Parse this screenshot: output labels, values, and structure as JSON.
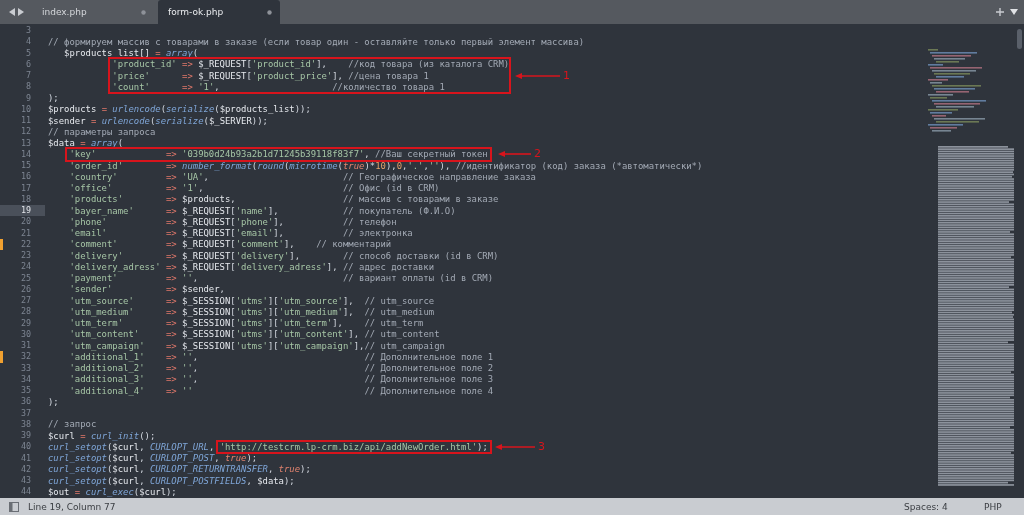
{
  "tabs": [
    {
      "label": "index.php",
      "selected": false
    },
    {
      "label": "form-ok.php",
      "selected": true
    }
  ],
  "lines": [
    {
      "number": "3",
      "current": false,
      "modified": false
    },
    {
      "number": "4",
      "current": false,
      "modified": false,
      "tokens": [
        {
          "kind": "comment",
          "text": "// формируем массив с товарами в заказе (если товар один - оставляйте только первый элемент массива)"
        }
      ]
    },
    {
      "number": "5",
      "current": false,
      "modified": false,
      "tokens": [
        {
          "kind": "var",
          "text": "   $products_list[]"
        },
        {
          "kind": "operator",
          "text": " = "
        },
        {
          "kind": "func",
          "text": "array"
        },
        {
          "kind": "text",
          "text": "("
        }
      ]
    },
    {
      "number": "6",
      "current": false,
      "modified": false,
      "tokens": [
        {
          "kind": "string",
          "text": "            'product_id'"
        },
        {
          "kind": "operator",
          "text": " => "
        },
        {
          "kind": "var",
          "text": "$_REQUEST"
        },
        {
          "kind": "text",
          "text": "["
        },
        {
          "kind": "string",
          "text": "'product_id'"
        },
        {
          "kind": "text",
          "text": "],    "
        },
        {
          "kind": "comment",
          "text": "//код товара (из каталога CRM)"
        }
      ]
    },
    {
      "number": "7",
      "current": false,
      "modified": false,
      "tokens": [
        {
          "kind": "string",
          "text": "            'price'"
        },
        {
          "kind": "operator",
          "text": "      => "
        },
        {
          "kind": "var",
          "text": "$_REQUEST"
        },
        {
          "kind": "text",
          "text": "["
        },
        {
          "kind": "string",
          "text": "'product_price'"
        },
        {
          "kind": "text",
          "text": "], "
        },
        {
          "kind": "comment",
          "text": "//цена товара 1"
        }
      ]
    },
    {
      "number": "8",
      "current": false,
      "modified": false,
      "tokens": [
        {
          "kind": "string",
          "text": "            'count'"
        },
        {
          "kind": "operator",
          "text": "      => "
        },
        {
          "kind": "string",
          "text": "'1'"
        },
        {
          "kind": "text",
          "text": ",                     "
        },
        {
          "kind": "comment",
          "text": "//количество товара 1"
        }
      ]
    },
    {
      "number": "9",
      "current": false,
      "modified": false,
      "tokens": [
        {
          "kind": "text",
          "text": ");"
        }
      ]
    },
    {
      "number": "10",
      "current": false,
      "modified": false,
      "tokens": [
        {
          "kind": "var",
          "text": "$products"
        },
        {
          "kind": "operator",
          "text": " = "
        },
        {
          "kind": "func",
          "text": "urlencode"
        },
        {
          "kind": "text",
          "text": "("
        },
        {
          "kind": "func",
          "text": "serialize"
        },
        {
          "kind": "text",
          "text": "("
        },
        {
          "kind": "var",
          "text": "$products_list"
        },
        {
          "kind": "text",
          "text": "));"
        }
      ]
    },
    {
      "number": "11",
      "current": false,
      "modified": false,
      "tokens": [
        {
          "kind": "var",
          "text": "$sender"
        },
        {
          "kind": "operator",
          "text": " = "
        },
        {
          "kind": "func",
          "text": "urlencode"
        },
        {
          "kind": "text",
          "text": "("
        },
        {
          "kind": "func",
          "text": "serialize"
        },
        {
          "kind": "text",
          "text": "("
        },
        {
          "kind": "var",
          "text": "$_SERVER"
        },
        {
          "kind": "text",
          "text": "));"
        }
      ]
    },
    {
      "number": "12",
      "current": false,
      "modified": false,
      "tokens": [
        {
          "kind": "comment",
          "text": "// параметры запроса"
        }
      ]
    },
    {
      "number": "13",
      "current": false,
      "modified": false,
      "tokens": [
        {
          "kind": "var",
          "text": "$data"
        },
        {
          "kind": "operator",
          "text": " = "
        },
        {
          "kind": "func",
          "text": "array"
        },
        {
          "kind": "text",
          "text": "("
        }
      ]
    },
    {
      "number": "14",
      "current": false,
      "modified": false,
      "tokens": [
        {
          "kind": "string",
          "text": "    'key'",
          "boxed": true
        },
        {
          "kind": "operator",
          "text": "             => ",
          "boxed": true
        },
        {
          "kind": "string",
          "text": "'039b0d24b93a2b1d71245b39118f83f7'",
          "boxed": true
        },
        {
          "kind": "text",
          "text": ", ",
          "boxed": true
        },
        {
          "kind": "comment",
          "text": "//Ваш секретный токен",
          "boxed": true
        }
      ]
    },
    {
      "number": "15",
      "current": false,
      "modified": false,
      "tokens": [
        {
          "kind": "string",
          "text": "    'order_id'"
        },
        {
          "kind": "operator",
          "text": "        => "
        },
        {
          "kind": "func",
          "text": "number_format"
        },
        {
          "kind": "text",
          "text": "("
        },
        {
          "kind": "func",
          "text": "round"
        },
        {
          "kind": "text",
          "text": "("
        },
        {
          "kind": "func",
          "text": "microtime"
        },
        {
          "kind": "text",
          "text": "("
        },
        {
          "kind": "keyword",
          "text": "true"
        },
        {
          "kind": "text",
          "text": ")*"
        },
        {
          "kind": "number",
          "text": "10"
        },
        {
          "kind": "text",
          "text": "),"
        },
        {
          "kind": "number",
          "text": "0"
        },
        {
          "kind": "text",
          "text": ","
        },
        {
          "kind": "string",
          "text": "'.'"
        },
        {
          "kind": "text",
          "text": ","
        },
        {
          "kind": "string",
          "text": "''"
        },
        {
          "kind": "text",
          "text": "), "
        },
        {
          "kind": "comment",
          "text": "//идентификатор (код) заказа (*автоматически*)"
        }
      ]
    },
    {
      "number": "16",
      "current": false,
      "modified": false,
      "tokens": [
        {
          "kind": "string",
          "text": "    'country'"
        },
        {
          "kind": "operator",
          "text": "         => "
        },
        {
          "kind": "string",
          "text": "'UA'"
        },
        {
          "kind": "text",
          "text": ",                         "
        },
        {
          "kind": "comment",
          "text": "// Географическое направление заказа"
        }
      ]
    },
    {
      "number": "17",
      "current": false,
      "modified": false,
      "tokens": [
        {
          "kind": "string",
          "text": "    'office'"
        },
        {
          "kind": "operator",
          "text": "          => "
        },
        {
          "kind": "string",
          "text": "'1'"
        },
        {
          "kind": "text",
          "text": ",                          "
        },
        {
          "kind": "comment",
          "text": "// Офис (id в CRM)"
        }
      ]
    },
    {
      "number": "18",
      "current": false,
      "modified": false,
      "tokens": [
        {
          "kind": "string",
          "text": "    'products'"
        },
        {
          "kind": "operator",
          "text": "        => "
        },
        {
          "kind": "var",
          "text": "$products"
        },
        {
          "kind": "text",
          "text": ",                    "
        },
        {
          "kind": "comment",
          "text": "// массив с товарами в заказе"
        }
      ]
    },
    {
      "number": "19",
      "current": true,
      "modified": false,
      "tokens": [
        {
          "kind": "string",
          "text": "    'bayer_name'"
        },
        {
          "kind": "operator",
          "text": "      => "
        },
        {
          "kind": "var",
          "text": "$_REQUEST"
        },
        {
          "kind": "text",
          "text": "["
        },
        {
          "kind": "string",
          "text": "'name'"
        },
        {
          "kind": "text",
          "text": "],            "
        },
        {
          "kind": "comment",
          "text": "// покупатель (Ф.И.О)"
        }
      ]
    },
    {
      "number": "20",
      "current": false,
      "modified": false,
      "tokens": [
        {
          "kind": "string",
          "text": "    'phone'"
        },
        {
          "kind": "operator",
          "text": "           => "
        },
        {
          "kind": "var",
          "text": "$_REQUEST"
        },
        {
          "kind": "text",
          "text": "["
        },
        {
          "kind": "string",
          "text": "'phone'"
        },
        {
          "kind": "text",
          "text": "],           "
        },
        {
          "kind": "comment",
          "text": "// телефон"
        }
      ]
    },
    {
      "number": "21",
      "current": false,
      "modified": false,
      "tokens": [
        {
          "kind": "string",
          "text": "    'email'"
        },
        {
          "kind": "operator",
          "text": "           => "
        },
        {
          "kind": "var",
          "text": "$_REQUEST"
        },
        {
          "kind": "text",
          "text": "["
        },
        {
          "kind": "string",
          "text": "'email'"
        },
        {
          "kind": "text",
          "text": "],           "
        },
        {
          "kind": "comment",
          "text": "// электронка"
        }
      ]
    },
    {
      "number": "22",
      "current": false,
      "modified": true,
      "tokens": [
        {
          "kind": "string",
          "text": "    'comment'"
        },
        {
          "kind": "operator",
          "text": "         => "
        },
        {
          "kind": "var",
          "text": "$_REQUEST"
        },
        {
          "kind": "text",
          "text": "["
        },
        {
          "kind": "string",
          "text": "'comment'"
        },
        {
          "kind": "text",
          "text": "],    "
        },
        {
          "kind": "comment",
          "text": "// комментарий"
        }
      ]
    },
    {
      "number": "23",
      "current": false,
      "modified": false,
      "tokens": [
        {
          "kind": "string",
          "text": "    'delivery'"
        },
        {
          "kind": "operator",
          "text": "        => "
        },
        {
          "kind": "var",
          "text": "$_REQUEST"
        },
        {
          "kind": "text",
          "text": "["
        },
        {
          "kind": "string",
          "text": "'delivery'"
        },
        {
          "kind": "text",
          "text": "],        "
        },
        {
          "kind": "comment",
          "text": "// способ доставки (id в CRM)"
        }
      ]
    },
    {
      "number": "24",
      "current": false,
      "modified": false,
      "tokens": [
        {
          "kind": "string",
          "text": "    'delivery_adress'"
        },
        {
          "kind": "operator",
          "text": " => "
        },
        {
          "kind": "var",
          "text": "$_REQUEST"
        },
        {
          "kind": "text",
          "text": "["
        },
        {
          "kind": "string",
          "text": "'delivery_adress'"
        },
        {
          "kind": "text",
          "text": "], "
        },
        {
          "kind": "comment",
          "text": "// адрес доставки"
        }
      ]
    },
    {
      "number": "25",
      "current": false,
      "modified": false,
      "tokens": [
        {
          "kind": "string",
          "text": "    'payment'"
        },
        {
          "kind": "operator",
          "text": "         => "
        },
        {
          "kind": "string",
          "text": "''"
        },
        {
          "kind": "text",
          "text": ",                           "
        },
        {
          "kind": "comment",
          "text": "// вариант оплаты (id в CRM)"
        }
      ]
    },
    {
      "number": "26",
      "current": false,
      "modified": false,
      "tokens": [
        {
          "kind": "string",
          "text": "    'sender'"
        },
        {
          "kind": "operator",
          "text": "          => "
        },
        {
          "kind": "var",
          "text": "$sender"
        },
        {
          "kind": "text",
          "text": ","
        }
      ]
    },
    {
      "number": "27",
      "current": false,
      "modified": false,
      "tokens": [
        {
          "kind": "string",
          "text": "    'utm_source'"
        },
        {
          "kind": "operator",
          "text": "      => "
        },
        {
          "kind": "var",
          "text": "$_SESSION"
        },
        {
          "kind": "text",
          "text": "["
        },
        {
          "kind": "string",
          "text": "'utms'"
        },
        {
          "kind": "text",
          "text": "]["
        },
        {
          "kind": "string",
          "text": "'utm_source'"
        },
        {
          "kind": "text",
          "text": "],  "
        },
        {
          "kind": "comment",
          "text": "// utm_source"
        }
      ]
    },
    {
      "number": "28",
      "current": false,
      "modified": false,
      "tokens": [
        {
          "kind": "string",
          "text": "    'utm_medium'"
        },
        {
          "kind": "operator",
          "text": "      => "
        },
        {
          "kind": "var",
          "text": "$_SESSION"
        },
        {
          "kind": "text",
          "text": "["
        },
        {
          "kind": "string",
          "text": "'utms'"
        },
        {
          "kind": "text",
          "text": "]["
        },
        {
          "kind": "string",
          "text": "'utm_medium'"
        },
        {
          "kind": "text",
          "text": "],  "
        },
        {
          "kind": "comment",
          "text": "// utm_medium"
        }
      ]
    },
    {
      "number": "29",
      "current": false,
      "modified": false,
      "tokens": [
        {
          "kind": "string",
          "text": "    'utm_term'"
        },
        {
          "kind": "operator",
          "text": "        => "
        },
        {
          "kind": "var",
          "text": "$_SESSION"
        },
        {
          "kind": "text",
          "text": "["
        },
        {
          "kind": "string",
          "text": "'utms'"
        },
        {
          "kind": "text",
          "text": "]["
        },
        {
          "kind": "string",
          "text": "'utm_term'"
        },
        {
          "kind": "text",
          "text": "],    "
        },
        {
          "kind": "comment",
          "text": "// utm_term"
        }
      ]
    },
    {
      "number": "30",
      "current": false,
      "modified": false,
      "tokens": [
        {
          "kind": "string",
          "text": "    'utm_content'"
        },
        {
          "kind": "operator",
          "text": "     => "
        },
        {
          "kind": "var",
          "text": "$_SESSION"
        },
        {
          "kind": "text",
          "text": "["
        },
        {
          "kind": "string",
          "text": "'utms'"
        },
        {
          "kind": "text",
          "text": "]["
        },
        {
          "kind": "string",
          "text": "'utm_content'"
        },
        {
          "kind": "text",
          "text": "], "
        },
        {
          "kind": "comment",
          "text": "// utm_content"
        }
      ]
    },
    {
      "number": "31",
      "current": false,
      "modified": false,
      "tokens": [
        {
          "kind": "string",
          "text": "    'utm_campaign'"
        },
        {
          "kind": "operator",
          "text": "    => "
        },
        {
          "kind": "var",
          "text": "$_SESSION"
        },
        {
          "kind": "text",
          "text": "["
        },
        {
          "kind": "string",
          "text": "'utms'"
        },
        {
          "kind": "text",
          "text": "]["
        },
        {
          "kind": "string",
          "text": "'utm_campaign'"
        },
        {
          "kind": "text",
          "text": "],"
        },
        {
          "kind": "comment",
          "text": "// utm_campaign"
        }
      ]
    },
    {
      "number": "32",
      "current": false,
      "modified": true,
      "tokens": [
        {
          "kind": "string",
          "text": "    'additional_1'"
        },
        {
          "kind": "operator",
          "text": "    => "
        },
        {
          "kind": "string",
          "text": "''"
        },
        {
          "kind": "text",
          "text": ",                               "
        },
        {
          "kind": "comment",
          "text": "// Дополнительное поле 1"
        }
      ]
    },
    {
      "number": "33",
      "current": false,
      "modified": false,
      "tokens": [
        {
          "kind": "string",
          "text": "    'additional_2'"
        },
        {
          "kind": "operator",
          "text": "    => "
        },
        {
          "kind": "string",
          "text": "''"
        },
        {
          "kind": "text",
          "text": ",                               "
        },
        {
          "kind": "comment",
          "text": "// Дополнительное поле 2"
        }
      ]
    },
    {
      "number": "34",
      "current": false,
      "modified": false,
      "tokens": [
        {
          "kind": "string",
          "text": "    'additional_3'"
        },
        {
          "kind": "operator",
          "text": "    => "
        },
        {
          "kind": "string",
          "text": "''"
        },
        {
          "kind": "text",
          "text": ",                               "
        },
        {
          "kind": "comment",
          "text": "// Дополнительное поле 3"
        }
      ]
    },
    {
      "number": "35",
      "current": false,
      "modified": false,
      "tokens": [
        {
          "kind": "string",
          "text": "    'additional_4'"
        },
        {
          "kind": "operator",
          "text": "    => "
        },
        {
          "kind": "string",
          "text": "''"
        },
        {
          "kind": "comment",
          "text": "                                // Дополнительное поле 4"
        }
      ]
    },
    {
      "number": "36",
      "current": false,
      "modified": false,
      "tokens": [
        {
          "kind": "text",
          "text": ");"
        }
      ]
    },
    {
      "number": "37",
      "current": false,
      "modified": false
    },
    {
      "number": "38",
      "current": false,
      "modified": false,
      "tokens": [
        {
          "kind": "comment",
          "text": "// запрос"
        }
      ]
    },
    {
      "number": "39",
      "current": false,
      "modified": false,
      "tokens": [
        {
          "kind": "var",
          "text": "$curl"
        },
        {
          "kind": "operator",
          "text": " = "
        },
        {
          "kind": "func",
          "text": "curl_init"
        },
        {
          "kind": "text",
          "text": "();"
        }
      ]
    },
    {
      "number": "40",
      "current": false,
      "modified": false,
      "tokens": [
        {
          "kind": "func",
          "text": "curl_setopt",
          "boxed": false
        },
        {
          "kind": "text",
          "text": "(",
          "boxed": false
        },
        {
          "kind": "var",
          "text": "$curl",
          "boxed": false
        },
        {
          "kind": "text",
          "text": ", ",
          "boxed": false
        },
        {
          "kind": "constant",
          "text": "CURLOPT_URL",
          "boxed": false
        },
        {
          "kind": "text",
          "text": ", ",
          "boxed": false
        },
        {
          "kind": "string",
          "text": "'http://testcrm.lp-crm.biz/api/addNewOrder.html'",
          "boxed": true
        },
        {
          "kind": "text",
          "text": ");",
          "boxed": true
        }
      ]
    },
    {
      "number": "41",
      "current": false,
      "modified": false,
      "tokens": [
        {
          "kind": "func",
          "text": "curl_setopt"
        },
        {
          "kind": "text",
          "text": "("
        },
        {
          "kind": "var",
          "text": "$curl"
        },
        {
          "kind": "text",
          "text": ", "
        },
        {
          "kind": "constant",
          "text": "CURLOPT_POST"
        },
        {
          "kind": "text",
          "text": ", "
        },
        {
          "kind": "keyword",
          "text": "true"
        },
        {
          "kind": "text",
          "text": ");"
        }
      ]
    },
    {
      "number": "42",
      "current": false,
      "modified": false,
      "tokens": [
        {
          "kind": "func",
          "text": "curl_setopt"
        },
        {
          "kind": "text",
          "text": "("
        },
        {
          "kind": "var",
          "text": "$curl"
        },
        {
          "kind": "text",
          "text": ", "
        },
        {
          "kind": "constant",
          "text": "CURLOPT_RETURNTRANSFER"
        },
        {
          "kind": "text",
          "text": ", "
        },
        {
          "kind": "keyword",
          "text": "true"
        },
        {
          "kind": "text",
          "text": ");"
        }
      ]
    },
    {
      "number": "43",
      "current": false,
      "modified": false,
      "tokens": [
        {
          "kind": "func",
          "text": "curl_setopt"
        },
        {
          "kind": "text",
          "text": "("
        },
        {
          "kind": "var",
          "text": "$curl"
        },
        {
          "kind": "text",
          "text": ", "
        },
        {
          "kind": "constant",
          "text": "CURLOPT_POSTFIELDS"
        },
        {
          "kind": "text",
          "text": ", "
        },
        {
          "kind": "var",
          "text": "$data"
        },
        {
          "kind": "text",
          "text": ");"
        }
      ]
    },
    {
      "number": "44",
      "current": false,
      "modified": false,
      "tokens": [
        {
          "kind": "var",
          "text": "$out"
        },
        {
          "kind": "operator",
          "text": " = "
        },
        {
          "kind": "func",
          "text": "curl_exec"
        },
        {
          "kind": "text",
          "text": "("
        },
        {
          "kind": "var",
          "text": "$curl"
        },
        {
          "kind": "text",
          "text": ");"
        }
      ]
    }
  ],
  "annotations": [
    {
      "label": "1"
    },
    {
      "label": "2"
    },
    {
      "label": "3"
    }
  ],
  "status_bar": {
    "position": "Line 19, Column 77",
    "indentation": "Spaces: 4",
    "syntax": "PHP"
  }
}
